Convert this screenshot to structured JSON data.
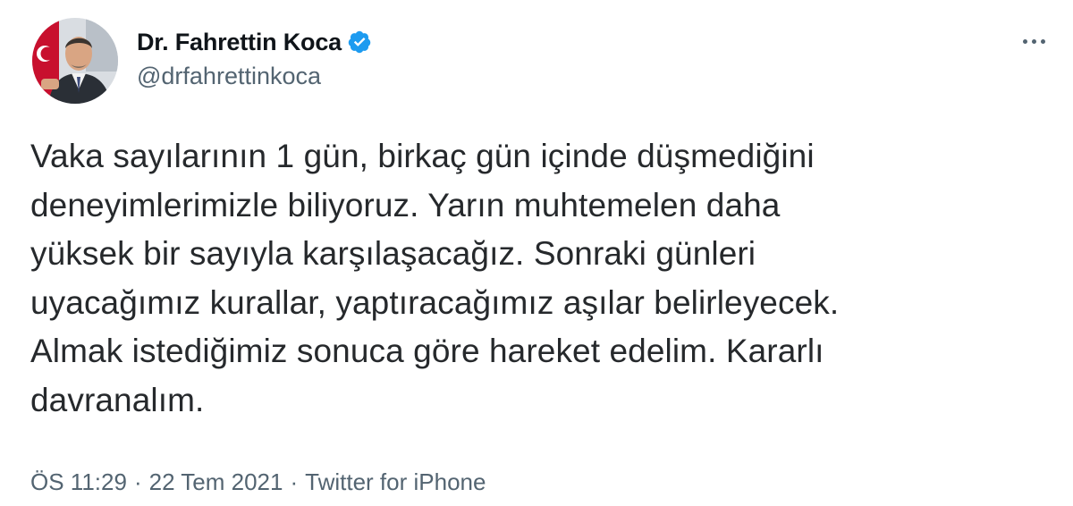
{
  "author": {
    "display_name": "Dr. Fahrettin Koca",
    "handle": "@drfahrettinkoca",
    "verified": true
  },
  "tweet": {
    "text": "Vaka sayılarının 1 gün, birkaç gün içinde düşmediğini\ndeneyimlerimizle biliyoruz. Yarın muhtemelen daha\nyüksek bir sayıyla karşılaşacağız. Sonraki günleri\nuyacağımız kurallar, yaptıracağımız aşılar belirleyecek.\nAlmak istediğimiz sonuca göre hareket edelim. Kararlı\ndavranalım."
  },
  "meta": {
    "time": "ÖS 11:29",
    "date": "22 Tem 2021",
    "separator": "·",
    "source": "Twitter for iPhone"
  },
  "colors": {
    "verified_badge": "#1d9bf0",
    "secondary_text": "#536471"
  },
  "icons": {
    "verified": "verified-badge-icon",
    "more": "more-options-icon"
  }
}
